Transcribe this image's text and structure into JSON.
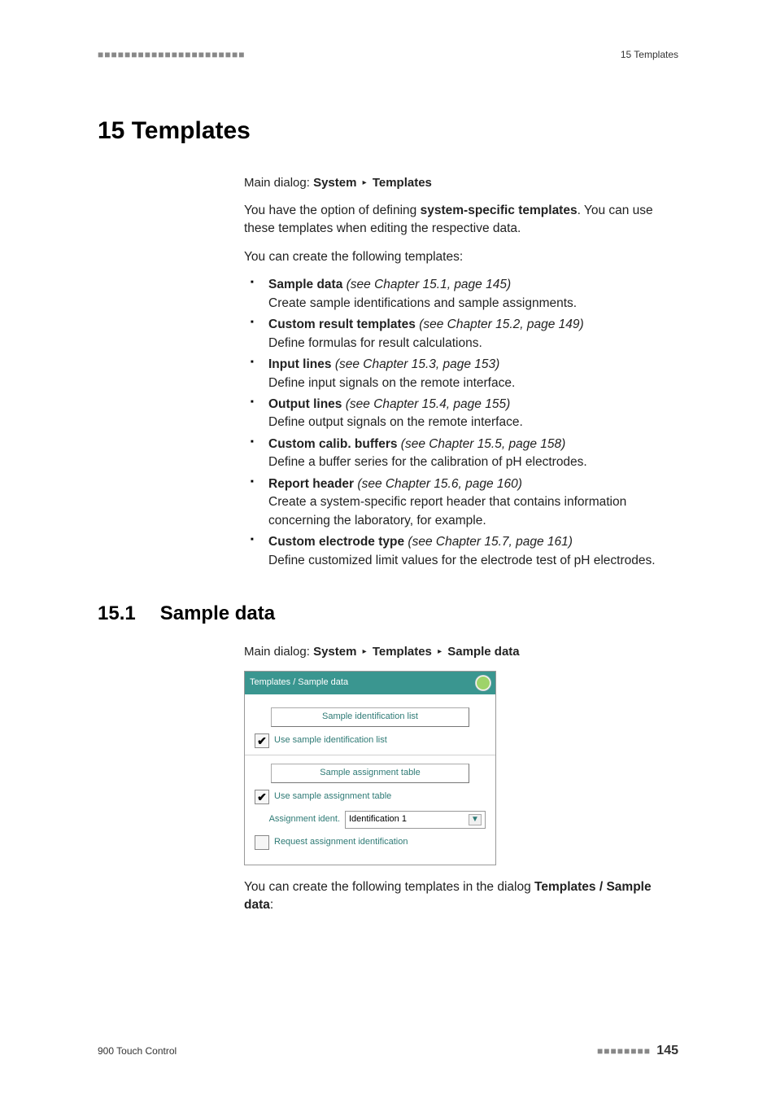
{
  "header": {
    "dots": "■■■■■■■■■■■■■■■■■■■■■■",
    "right": "15 Templates"
  },
  "chapter": {
    "title": "15 Templates"
  },
  "crumb1": {
    "prefix": "Main dialog: ",
    "p1": "System",
    "p2": "Templates"
  },
  "intro": {
    "p1a": "You have the option of defining ",
    "p1b": "system-specific templates",
    "p1c": ". You can use these templates when editing the respective data.",
    "p2": "You can create the following templates:"
  },
  "list": [
    {
      "title": "Sample data",
      "ref": "(see Chapter 15.1, page 145)",
      "desc": "Create sample identifications and sample assignments."
    },
    {
      "title": "Custom result templates",
      "ref": "(see Chapter 15.2, page 149)",
      "desc": "Define formulas for result calculations."
    },
    {
      "title": "Input lines",
      "ref": "(see Chapter 15.3, page 153)",
      "desc": "Define input signals on the remote interface."
    },
    {
      "title": "Output lines",
      "ref": "(see Chapter 15.4, page 155)",
      "desc": "Define output signals on the remote interface."
    },
    {
      "title": "Custom calib. buffers",
      "ref": "(see Chapter 15.5, page 158)",
      "desc": "Define a buffer series for the calibration of pH electrodes."
    },
    {
      "title": "Report header",
      "ref": "(see Chapter 15.6, page 160)",
      "desc": "Create a system-specific report header that contains information concerning the laboratory, for example."
    },
    {
      "title": "Custom electrode type",
      "ref": "(see Chapter 15.7, page 161)",
      "desc": "Define customized limit values for the electrode test of pH electrodes."
    }
  ],
  "section": {
    "num": "15.1",
    "title": "Sample data"
  },
  "crumb2": {
    "prefix": "Main dialog: ",
    "p1": "System",
    "p2": "Templates",
    "p3": "Sample data"
  },
  "dialog": {
    "title": "Templates / Sample data",
    "section1": "Sample identification list",
    "check1": "Use sample identification list",
    "section2": "Sample assignment table",
    "check2": "Use sample assignment table",
    "fieldLabel": "Assignment ident.",
    "fieldValue": "Identification 1",
    "check3": "Request assignment identification"
  },
  "outro": {
    "a": "You can create the following templates in the dialog ",
    "b": "Templates / Sample data",
    "c": ":"
  },
  "footer": {
    "product": "900 Touch Control",
    "dots": "■■■■■■■■",
    "page": "145"
  },
  "glyph": {
    "tri": "▸",
    "check": "✔",
    "down": "▼"
  }
}
